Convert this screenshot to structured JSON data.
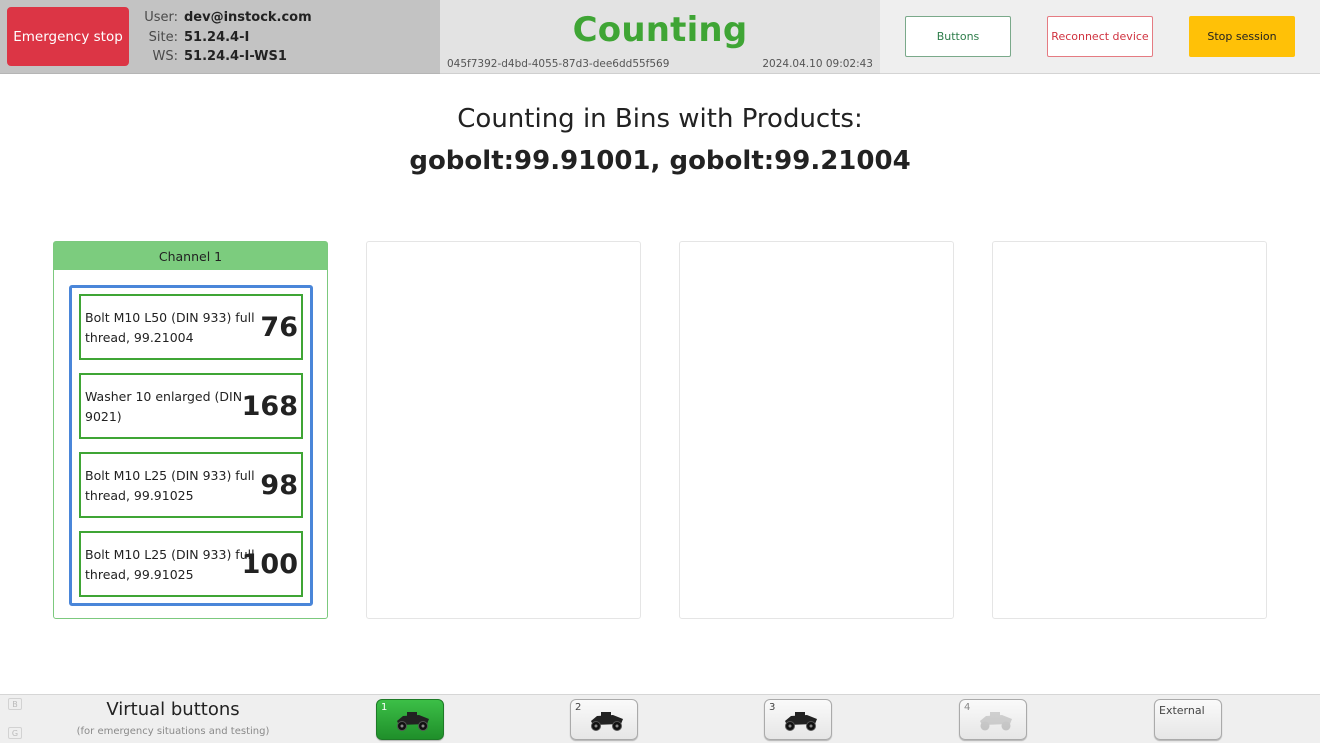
{
  "header": {
    "emergency_stop_label": "Emergency stop",
    "user_label": "User:",
    "user_value": "dev@instock.com",
    "site_label": "Site:",
    "site_value": "51.24.4-I",
    "ws_label": "WS:",
    "ws_value": "51.24.4-I-WS1",
    "status": "Counting",
    "session_id": "045f7392-d4bd-4055-87d3-dee6dd55f569",
    "timestamp": "2024.04.10 09:02:43",
    "buttons_label": "Buttons",
    "reconnect_label": "Reconnect device",
    "stop_session_label": "Stop session"
  },
  "title": {
    "line1": "Counting in Bins with Products:",
    "line2": "gobolt:99.91001,  gobolt:99.21004"
  },
  "channels": [
    {
      "label": "Channel 1",
      "products": [
        {
          "name": "Bolt M10 L50 (DIN 933) full thread, 99.21004",
          "count": "76"
        },
        {
          "name": "Washer 10 enlarged (DIN 9021)",
          "count": "168"
        },
        {
          "name": "Bolt M10 L25 (DIN 933) full thread, 99.91025",
          "count": "98"
        },
        {
          "name": "Bolt M10 L25 (DIN 933) full thread, 99.91025",
          "count": "100"
        }
      ]
    }
  ],
  "footer": {
    "key_hint_b": "B",
    "key_hint_g": "G",
    "virtual_buttons_title": "Virtual buttons",
    "virtual_buttons_subtitle": "(for emergency situations and testing)",
    "buttons": [
      {
        "label": "1",
        "state": "active",
        "icon": "robot-car-icon"
      },
      {
        "label": "2",
        "state": "normal",
        "icon": "robot-car-icon"
      },
      {
        "label": "3",
        "state": "normal",
        "icon": "robot-car-icon"
      },
      {
        "label": "4",
        "state": "disabled",
        "icon": "robot-car-icon"
      },
      {
        "label": "External",
        "state": "normal"
      }
    ]
  },
  "colors": {
    "emergency": "#dc3545",
    "status_green": "#3fa535",
    "stop_session": "#ffc107",
    "bin_border": "#4a86d9",
    "channel_header": "#7ccc7e"
  }
}
